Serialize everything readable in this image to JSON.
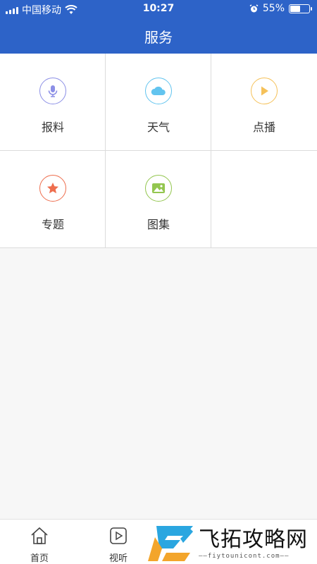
{
  "status_bar": {
    "carrier": "中国移动",
    "time": "10:27",
    "battery_percent_text": "55%",
    "battery_level": 0.55
  },
  "header": {
    "title": "服务"
  },
  "services": [
    {
      "label": "报料",
      "icon": "microphone-icon",
      "color": "#8c8fe6"
    },
    {
      "label": "天气",
      "icon": "cloud-icon",
      "color": "#62c4ef"
    },
    {
      "label": "点播",
      "icon": "play-icon",
      "color": "#f5c159"
    },
    {
      "label": "专题",
      "icon": "star-icon",
      "color": "#ee6e4e"
    },
    {
      "label": "图集",
      "icon": "image-icon",
      "color": "#93c64f"
    }
  ],
  "tabbar": {
    "items": [
      {
        "label": "首页",
        "icon": "home-icon"
      },
      {
        "label": "视听",
        "icon": "play-box-icon"
      }
    ]
  },
  "watermark": {
    "text": "飞拓攻略网",
    "subtext": "——fiytounicont.com——"
  },
  "colors": {
    "header_bg": "#2d63c8",
    "page_bg": "#f7f7f7"
  }
}
